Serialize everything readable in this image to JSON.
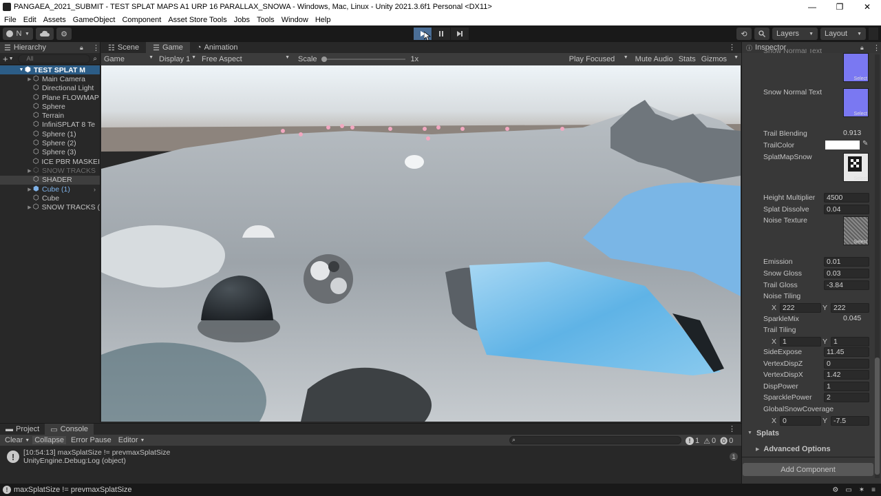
{
  "window": {
    "title": "PANGAEA_2021_SUBMIT - TEST SPLAT MAPS A1 URP 16 PARALLAX_SNOWA - Windows, Mac, Linux - Unity 2021.3.6f1 Personal <DX11>",
    "minimize": "—",
    "maximize": "❐",
    "close": "✕"
  },
  "menu": [
    "File",
    "Edit",
    "Assets",
    "GameObject",
    "Component",
    "Asset Store Tools",
    "Jobs",
    "Tools",
    "Window",
    "Help"
  ],
  "toolbar": {
    "account_initial": "N",
    "layers_label": "Layers",
    "layout_label": "Layout"
  },
  "hierarchy": {
    "tab_label": "Hierarchy",
    "search_placeholder": "All",
    "scene_name": "TEST SPLAT M",
    "items": [
      {
        "label": "Main Camera",
        "state": "normal"
      },
      {
        "label": "Directional Light",
        "state": "normal"
      },
      {
        "label": "Plane FLOWMAP",
        "state": "normal"
      },
      {
        "label": "Sphere",
        "state": "normal"
      },
      {
        "label": "Terrain",
        "state": "normal"
      },
      {
        "label": "InfiniSPLAT 8 Te",
        "state": "normal"
      },
      {
        "label": "Sphere (1)",
        "state": "normal"
      },
      {
        "label": "Sphere (2)",
        "state": "normal"
      },
      {
        "label": "Sphere (3)",
        "state": "normal"
      },
      {
        "label": "ICE PBR MASKEI",
        "state": "normal"
      },
      {
        "label": "SNOW TRACKS",
        "state": "dim"
      },
      {
        "label": "SHADER",
        "state": "selected"
      },
      {
        "label": "Cube (1)",
        "state": "prefab"
      },
      {
        "label": "Cube",
        "state": "normal"
      },
      {
        "label": "SNOW TRACKS (",
        "state": "normal"
      }
    ]
  },
  "game_view": {
    "tabs": [
      "Scene",
      "Game",
      "Animation"
    ],
    "display_mode": "Game",
    "display": "Display 1",
    "aspect": "Free Aspect",
    "scale_label": "Scale",
    "scale_value": "1x",
    "scale_fraction": 0.0,
    "play_mode": "Play Focused",
    "mute_audio": "Mute Audio",
    "stats": "Stats",
    "gizmos": "Gizmos"
  },
  "inspector": {
    "tab_label": "Inspector",
    "top_cut_label": "Snow Normal Text",
    "snow_normal_label": "Snow Normal Text",
    "select": "Select",
    "trail_blending": {
      "label": "Trail Blending",
      "value": "0.913"
    },
    "trail_color_label": "TrailColor",
    "splatmap_snow_label": "SplatMapSnow",
    "height_multiplier": {
      "label": "Height Multiplier",
      "value": "4500"
    },
    "splat_dissolve": {
      "label": "Splat Dissolve",
      "value": "0.04"
    },
    "noise_texture_label": "Noise Texture",
    "emission": {
      "label": "Emission",
      "value": "0.01"
    },
    "snow_gloss": {
      "label": "Snow Gloss",
      "value": "0.03"
    },
    "trail_gloss": {
      "label": "Trail Gloss",
      "value": "-3.84"
    },
    "noise_tiling": {
      "label": "Noise Tiling",
      "x": "222",
      "y": "222"
    },
    "sparkle_mix": {
      "label": "SparkleMix",
      "value": "0.045"
    },
    "trail_tiling": {
      "label": "Trail Tiling",
      "x": "1",
      "y": "1"
    },
    "side_expose": {
      "label": "SideExpose",
      "value": "11.45"
    },
    "vertex_disp_z": {
      "label": "VertexDispZ",
      "value": "0"
    },
    "vertex_disp_x": {
      "label": "VertexDispX",
      "value": "1.42"
    },
    "disp_power": {
      "label": "DispPower",
      "value": "1"
    },
    "sparkle_power": {
      "label": "SparcklePower",
      "value": "2"
    },
    "global_snow_coverage": {
      "label": "GlobalSnowCoverage",
      "x": "0",
      "y": "-7.5"
    },
    "x_label": "X",
    "y_label": "Y",
    "splats_label": "Splats",
    "advanced_label": "Advanced Options",
    "add_component": "Add Component"
  },
  "console": {
    "tabs": [
      "Project",
      "Console"
    ],
    "clear": "Clear",
    "collapse": "Collapse",
    "error_pause": "Error Pause",
    "editor": "Editor",
    "count_info": "1",
    "count_warn": "0",
    "count_error": "0",
    "log_line1": "[10:54:13] maxSplatSize != prevmaxSplatSize",
    "log_line2": "UnityEngine.Debug:Log (object)",
    "log_count": "1"
  },
  "status": {
    "message": "maxSplatSize != prevmaxSplatSize"
  }
}
